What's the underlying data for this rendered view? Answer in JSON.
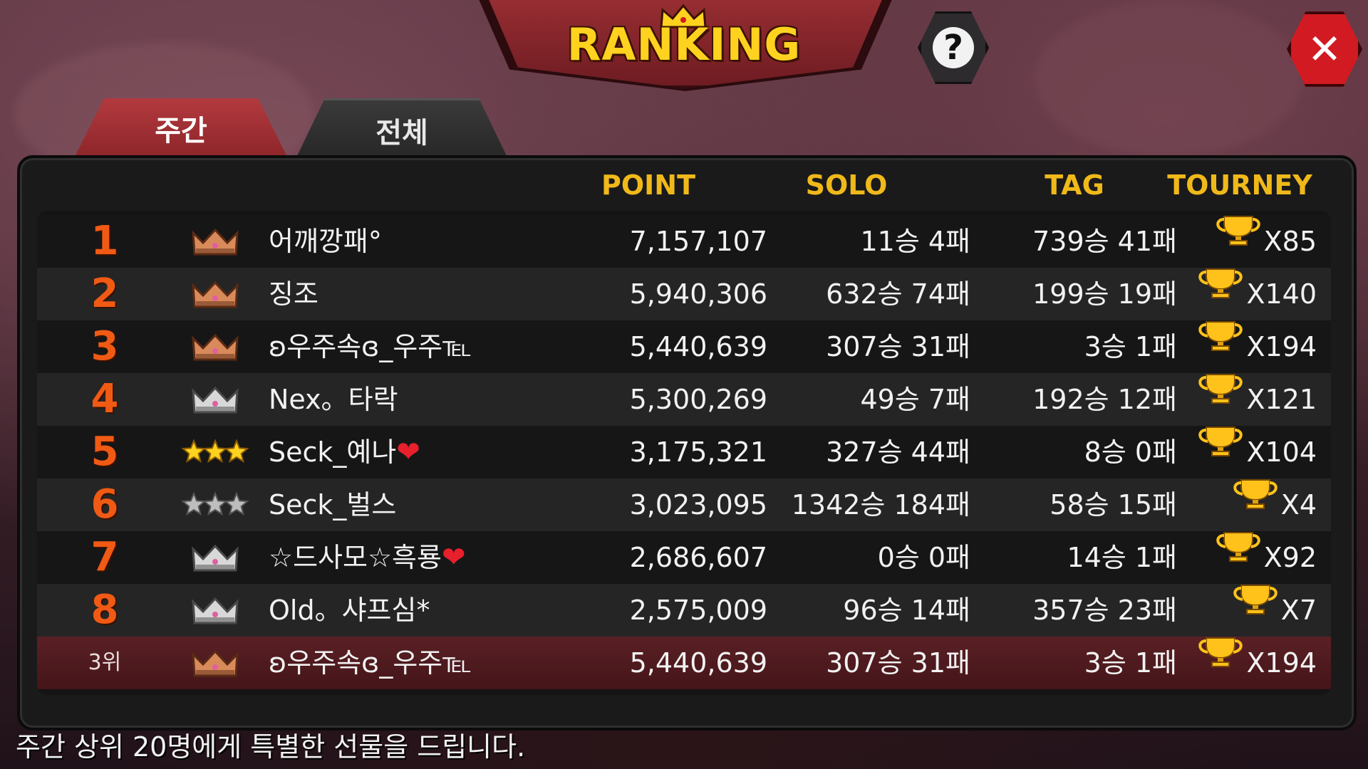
{
  "title": "RANKING",
  "help_icon": "question-icon",
  "close_icon": "close-icon",
  "tabs": [
    {
      "label": "주간",
      "active": true
    },
    {
      "label": "전체",
      "active": false
    }
  ],
  "columns": {
    "point": "POINT",
    "solo": "SOLO",
    "tag": "TAG",
    "tourney": "TOURNEY"
  },
  "rows": [
    {
      "rank": "1",
      "badge": "crown-gold",
      "name": "어깨깡패°",
      "point": "7,157,107",
      "solo": "11승 4패",
      "tag": "739승 41패",
      "tourney": "X85"
    },
    {
      "rank": "2",
      "badge": "crown-gold",
      "name": "징조",
      "point": "5,940,306",
      "solo": "632승 74패",
      "tag": "199승 19패",
      "tourney": "X140"
    },
    {
      "rank": "3",
      "badge": "crown-gold",
      "name": "ʚ우주속ɞ_우주℡",
      "point": "5,440,639",
      "solo": "307승 31패",
      "tag": "3승 1패",
      "tourney": "X194"
    },
    {
      "rank": "4",
      "badge": "crown-silver",
      "name": "Nex。타락",
      "point": "5,300,269",
      "solo": "49승 7패",
      "tag": "192승 12패",
      "tourney": "X121"
    },
    {
      "rank": "5",
      "badge": "stars-gold",
      "name": "Seck_예나",
      "heart": true,
      "point": "3,175,321",
      "solo": "327승 44패",
      "tag": "8승 0패",
      "tourney": "X104"
    },
    {
      "rank": "6",
      "badge": "stars-silver",
      "name": "Seck_벌스",
      "point": "3,023,095",
      "solo": "1342승 184패",
      "tag": "58승 15패",
      "tourney": "X4"
    },
    {
      "rank": "7",
      "badge": "crown-silver",
      "name": "☆드사모☆흑룡",
      "heart": true,
      "point": "2,686,607",
      "solo": "0승 0패",
      "tag": "14승 1패",
      "tourney": "X92"
    },
    {
      "rank": "8",
      "badge": "crown-silver",
      "name": "Old。샤프심*",
      "point": "2,575,009",
      "solo": "96승 14패",
      "tag": "357승 23패",
      "tourney": "X7"
    }
  ],
  "my_row": {
    "rank": "3위",
    "badge": "crown-gold",
    "name": "ʚ우주속ɞ_우주℡",
    "point": "5,440,639",
    "solo": "307승 31패",
    "tag": "3승 1패",
    "tourney": "X194"
  },
  "footer": "주간 상위 20명에게 특별한 선물을 드립니다.",
  "colors": {
    "accent": "#f0b91a",
    "title": "#ffd21f",
    "rank": "#f05a14",
    "close": "#d11a22",
    "tab_active": "#b33a3f"
  }
}
